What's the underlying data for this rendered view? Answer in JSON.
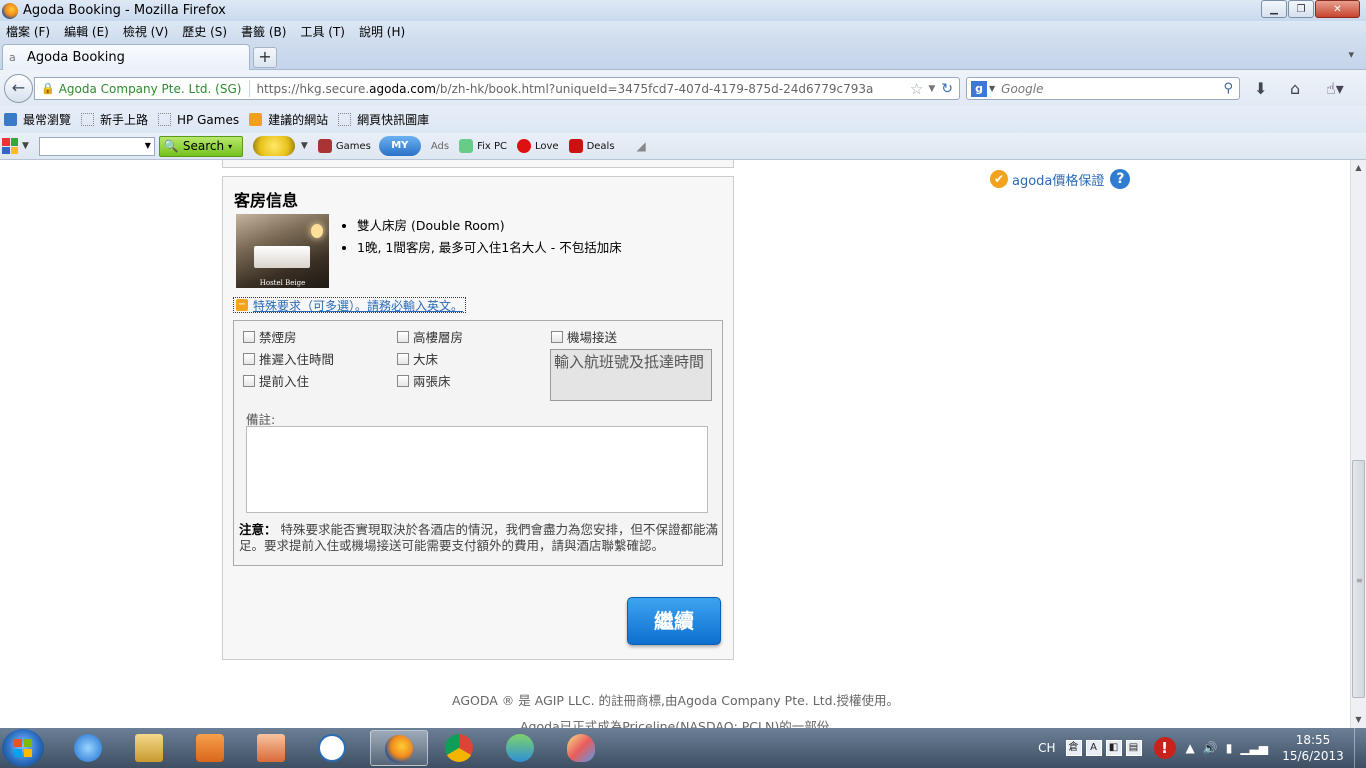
{
  "window": {
    "title": "Agoda Booking - Mozilla Firefox"
  },
  "menu": [
    "檔案 (F)",
    "編輯 (E)",
    "檢視 (V)",
    "歷史 (S)",
    "書籤 (B)",
    "工具 (T)",
    "說明 (H)"
  ],
  "tab": {
    "label": "Agoda Booking",
    "new_tab": "+"
  },
  "navbar": {
    "identity": "Agoda Company Pte. Ltd. (SG)",
    "url_prefix": "https://hkg.secure.",
    "url_domain": "agoda.com",
    "url_suffix": "/b/zh-hk/book.html?uniqueId=3475fcd7-407d-4179-875d-24d6779c793a",
    "search_placeholder": "Google"
  },
  "bookmarks": [
    "最常瀏覽",
    "新手上路",
    "HP Games",
    "建議的網站",
    "網頁快訊圖庫"
  ],
  "hp_toolbar": {
    "search_label": "Search",
    "games": "Games",
    "my": "MY",
    "ads": "Ads",
    "fixpc": "Fix PC",
    "love": "Love",
    "deals": "Deals"
  },
  "room": {
    "heading": "客房信息",
    "photo_caption": "Hostel Beige",
    "bullets": [
      "雙人床房 (Double Room)",
      "1晚, 1間客房, 最多可入住1名大人 - 不包括加床"
    ],
    "special_link": "特殊要求（可多選）。請務必輸入英文。"
  },
  "requests": {
    "col1": [
      "禁煙房",
      "推遲入住時間",
      "提前入住"
    ],
    "col2": [
      "高樓層房",
      "大床",
      "兩張床"
    ],
    "col3": [
      "機場接送"
    ],
    "flight_placeholder": "輸入航班號及抵達時間",
    "remark_label": "備註:",
    "notice_bold": "注意：",
    "notice_text": " 特殊要求能否實現取決於各酒店的情況，我們會盡力為您安排，但不保證都能滿足。要求提前入住或機場接送可能需要支付額外的費用，請與酒店聯繫確認。"
  },
  "continue_label": "繼續",
  "guarantee": {
    "label": "agoda價格保證",
    "help": "?"
  },
  "footer": {
    "line1": "AGODA ® 是 AGIP LLC. 的註冊商標,由Agoda Company Pte. Ltd.授權使用。",
    "line2": "Agoda已正式成為Priceline(NASDAQ: PCLN)的一部份"
  },
  "taskbar": {
    "lang": "CH",
    "time": "18:55",
    "date": "15/6/2013"
  },
  "colors": {
    "continue_button": "#1a80dc",
    "link": "#2a6ab8",
    "guarantee_check": "#f3a21e"
  }
}
